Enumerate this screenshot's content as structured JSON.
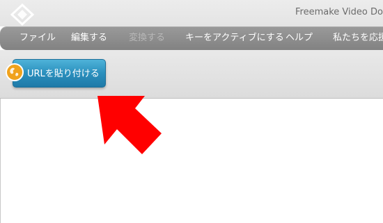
{
  "window": {
    "title": "Freemake Video Dow"
  },
  "menu": {
    "items": [
      {
        "label": "ファイル",
        "enabled": true
      },
      {
        "label": "編集する",
        "enabled": true
      },
      {
        "label": "変換する",
        "enabled": false
      },
      {
        "label": "キーをアクティブにする",
        "enabled": true
      },
      {
        "label": "ヘルプ",
        "enabled": true
      },
      {
        "label": "私たちを応援し",
        "enabled": true
      }
    ]
  },
  "toolbar": {
    "paste_url_label": "URLを貼り付ける"
  },
  "icons": {
    "logo": "freemake-logo-icon",
    "globe": "globe-icon",
    "arrow": "red-arrow-icon"
  },
  "colors": {
    "menubar": "#8c8c8c",
    "button": "#2a8fbd",
    "arrow": "#ff0000",
    "globe": "#f0a21c"
  }
}
